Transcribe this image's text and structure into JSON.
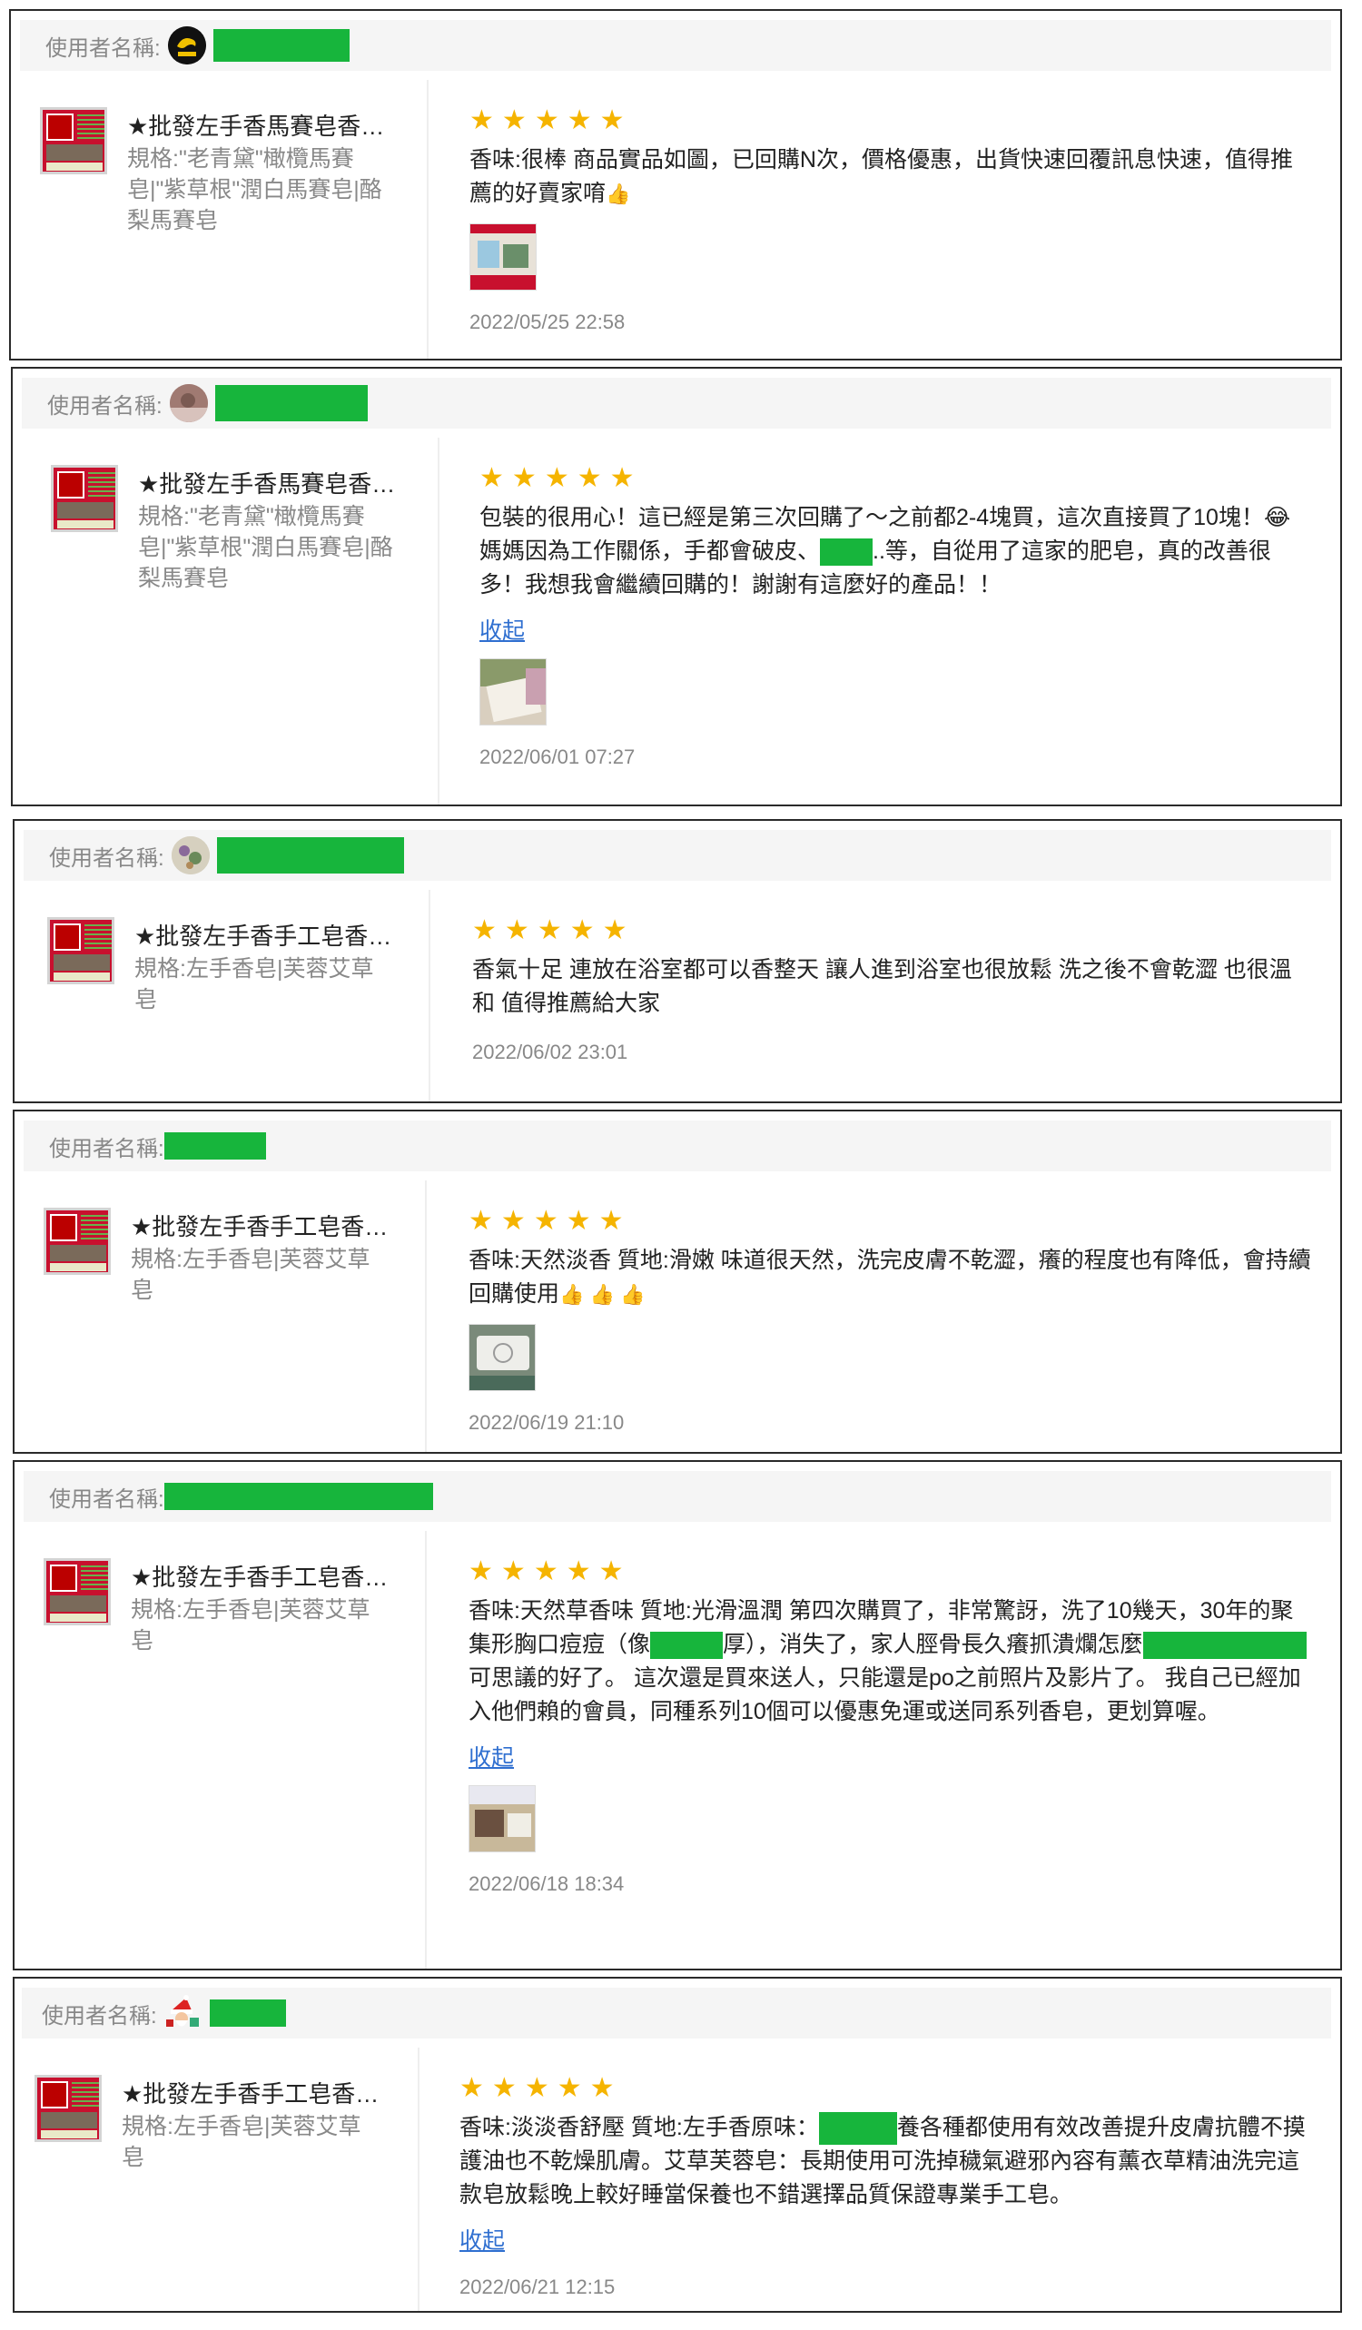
{
  "labels": {
    "username": "使用者名稱:",
    "collapse": "收起"
  },
  "colors": {
    "star": "#f5b400",
    "redaction": "#17b53c",
    "link": "#2f6fd0"
  },
  "reviews": [
    {
      "product_name": "★批發左手香馬賽皂香…",
      "spec": "規格:\"老青黛\"橄欖馬賽皂|\"紫草根\"潤白馬賽皂|酪梨馬賽皂",
      "rating": 5,
      "text": "香味:很棒 商品實品如圖，已回購N次，價格優惠，出貨快速回覆訊息快速，值得推薦的好賣家唷",
      "emoji": "👍",
      "has_image": true,
      "has_collapse": false,
      "date": "2022/05/25 22:58",
      "avatar_icon": "bird-logo-icon"
    },
    {
      "product_name": "★批發左手香馬賽皂香…",
      "spec": "規格:\"老青黛\"橄欖馬賽皂|\"紫草根\"潤白馬賽皂|酪梨馬賽皂",
      "rating": 5,
      "text_parts": [
        "包裝的很用心！這已經是第三次回購了～之前都2-4塊買，這次直接買了10塊！😂媽媽因為工作關係，手都會破皮、",
        "..等，自從用了這家的肥皂，真的改善很多！我想我會繼續回購的！謝謝有這麼好的產品！！"
      ],
      "has_image": true,
      "has_collapse": true,
      "date": "2022/06/01 07:27",
      "avatar_icon": "photo-avatar-icon"
    },
    {
      "product_name": "★批發左手香手工皂香…",
      "spec": "規格:左手香皂|芙蓉艾草皂",
      "rating": 5,
      "text": "香氣十足 連放在浴室都可以香整天 讓人進到浴室也很放鬆 洗之後不會乾澀 也很溫和 值得推薦給大家",
      "has_image": false,
      "has_collapse": false,
      "date": "2022/06/02 23:01",
      "avatar_icon": "flower-avatar-icon"
    },
    {
      "product_name": "★批發左手香手工皂香…",
      "spec": "規格:左手香皂|芙蓉艾草皂",
      "rating": 5,
      "text": "香味:天然淡香 質地:滑嫩 味道很天然，洗完皮膚不乾澀，癢的程度也有降低，會持續回購使用",
      "emoji": "👍 👍 👍",
      "has_image": true,
      "has_collapse": false,
      "date": "2022/06/19 21:10",
      "avatar_icon": ""
    },
    {
      "product_name": "★批發左手香手工皂香…",
      "spec": "規格:左手香皂|芙蓉艾草皂",
      "rating": 5,
      "text_parts": [
        "香味:天然草香味 質地:光滑溫潤 第四次購買了，非常驚訝，洗了10幾天，30年的聚集形胸口痘痘（像",
        "厚），消失了，家人脛骨長久癢抓潰爛怎麼",
        "",
        "可思議的好了。 這次還是買來送人，只能還是po之前照片及影片了。 我自己已經加入他們賴的會員，同種系列10個可以優惠免運或送同系列香皂，更划算喔。"
      ],
      "has_image": true,
      "has_collapse": true,
      "date": "2022/06/18 18:34",
      "avatar_icon": ""
    },
    {
      "product_name": "★批發左手香手工皂香…",
      "spec": "規格:左手香皂|芙蓉艾草皂",
      "rating": 5,
      "text_parts": [
        "香味:淡淡香舒壓 質地:左手香原味：",
        "養各種都使用有效改善提升皮膚抗體不摸護油也不乾燥肌膚。艾草芙蓉皂：長期使用可洗掉穢氣避邪內容有薰衣草精油洗完這款皂放鬆晚上較好睡當保養也不錯選擇品質保證專業手工皂。"
      ],
      "has_image": false,
      "has_collapse": true,
      "date": "2022/06/21 12:15",
      "avatar_icon": "santa-avatar-icon"
    }
  ]
}
